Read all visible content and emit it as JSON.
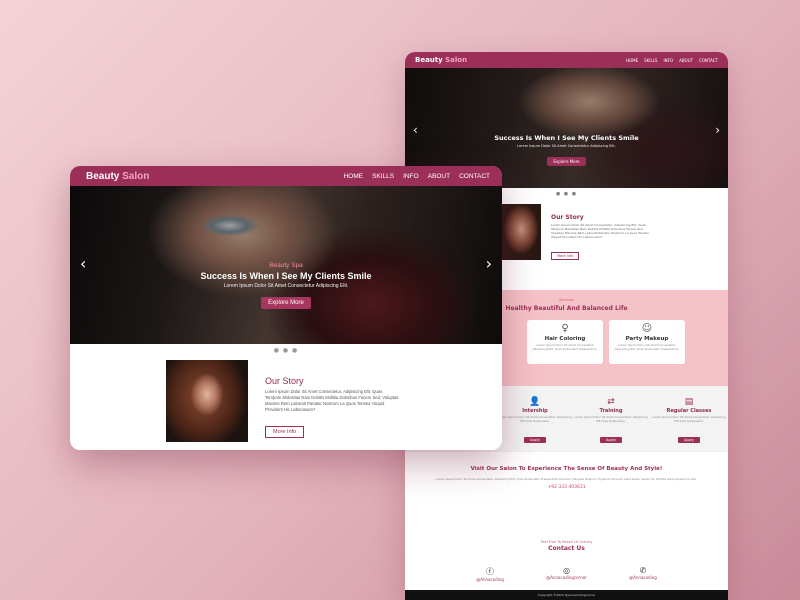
{
  "brand": {
    "name": "Beauty",
    "accent": "Salon",
    "color": "#9c2f57"
  },
  "nav": [
    "HOME",
    "SKILLS",
    "INFO",
    "ABOUT",
    "CONTACT"
  ],
  "hero": {
    "eyebrow": "Beauty Spa",
    "title": "Success Is When I See My Clients Smile",
    "subtitle": "Lorem Ipsum Dolor Sit Amet Consectetur Adipiscing Elit.",
    "button": "Explore More",
    "prev_icon": "chevron-left-icon",
    "next_icon": "chevron-right-icon",
    "dots": "● ● ●"
  },
  "story": {
    "title": "Our Story",
    "text": "Lorem Ipsum Dolor Sit Amet Consectetur, Adipisicing Elit. Quas Tempore Molestias Nam Debitis Mollitia Doloribus Facere Sed, Voluptas Maxime Rem Laborati Pariatur Nostrum La Quos Tenetur Aliquid Provident Hic Laboriosam?",
    "button": "More Info"
  },
  "services": {
    "eyebrow": "Services",
    "title": "Healthy Beautiful And Balanced Life",
    "items": [
      {
        "name": "Hair Coloring",
        "icon": "hair-icon",
        "text": "Lorem Ipsum Dolor Sit Amet Consectetur Adipisicing Elit. Quia Quibusdam Praesentium."
      },
      {
        "name": "Party Makeup",
        "icon": "makeup-icon",
        "text": "Lorem Ipsum Dolor Sit Amet Consectetur Adipisicing Elit. Quia Quibusdam Praesentium."
      }
    ]
  },
  "programs": {
    "items": [
      {
        "name": "Intership",
        "icon": "user-plus-icon",
        "text": "Lorem Ipsum Dolor Sit Amet Consectetur Adipisicing Elit Quia Quibusdam.",
        "button": "Apply"
      },
      {
        "name": "Training",
        "icon": "shuffle-icon",
        "text": "Lorem Ipsum Dolor Sit Amet Consectetur Adipisicing Elit Quia Quibusdam.",
        "button": "Apply"
      },
      {
        "name": "Regular Classes",
        "icon": "clipboard-icon",
        "text": "Lorem Ipsum Dolor Sit Amet Consectetur Adipisicing Elit Quia Quibusdam.",
        "button": "Apply"
      }
    ]
  },
  "visit": {
    "title": "Visit Our Salon To Experience The Sense Of Beauty And Style!",
    "text": "Lorem Ipsum Dolor Sit Amet Consectetur Adipisicing Elit. Quia Quibusdam Praesentium Dolorem Voluptas Nostrum Fugiat Dicta Quod Laboriosam Soluta Hic Mollitia Magni Possimus Ipsa.",
    "phone": "+92 333 403631"
  },
  "contact": {
    "eyebrow": "Feel Free To Reach Us Quickly",
    "title": "Contact Us",
    "socials": [
      {
        "icon": "facebook-icon",
        "handle": "@Annacoding"
      },
      {
        "icon": "instagram-icon",
        "handle": "@Annacodingcorner"
      },
      {
        "icon": "whatsapp-icon",
        "handle": "@Annacoding"
      }
    ]
  },
  "footer": {
    "text": "Copyright ©2023 @Annacodingcorner"
  }
}
